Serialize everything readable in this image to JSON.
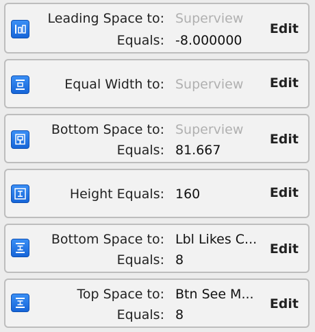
{
  "constraints": [
    {
      "label1": "Leading Space to:",
      "value1": "Superview",
      "label2": "Equals:",
      "value2": "-8.000000",
      "action": "Edit"
    },
    {
      "label1": "Equal Width to:",
      "value1": "Superview",
      "action": "Edit"
    },
    {
      "label1": "Bottom Space to:",
      "value1": "Superview",
      "label2": "Equals:",
      "value2": "81.667",
      "action": "Edit"
    },
    {
      "label1": "Height Equals:",
      "value1": "160",
      "action": "Edit"
    },
    {
      "label1": "Bottom Space to:",
      "value1": "Lbl Likes C...",
      "label2": "Equals:",
      "value2": "8",
      "action": "Edit"
    },
    {
      "label1": "Top Space to:",
      "value1": "Btn See M...",
      "label2": "Equals:",
      "value2": "8",
      "action": "Edit"
    }
  ],
  "icons": [
    "leading-space-icon",
    "equal-width-icon",
    "bottom-space-icon",
    "height-icon",
    "vertical-space-icon",
    "vertical-space-icon"
  ],
  "colors": {
    "icon_blue": "#1a6fe0",
    "placeholder_gray": "#b0b0b0",
    "panel_border": "#bdbdbd"
  }
}
